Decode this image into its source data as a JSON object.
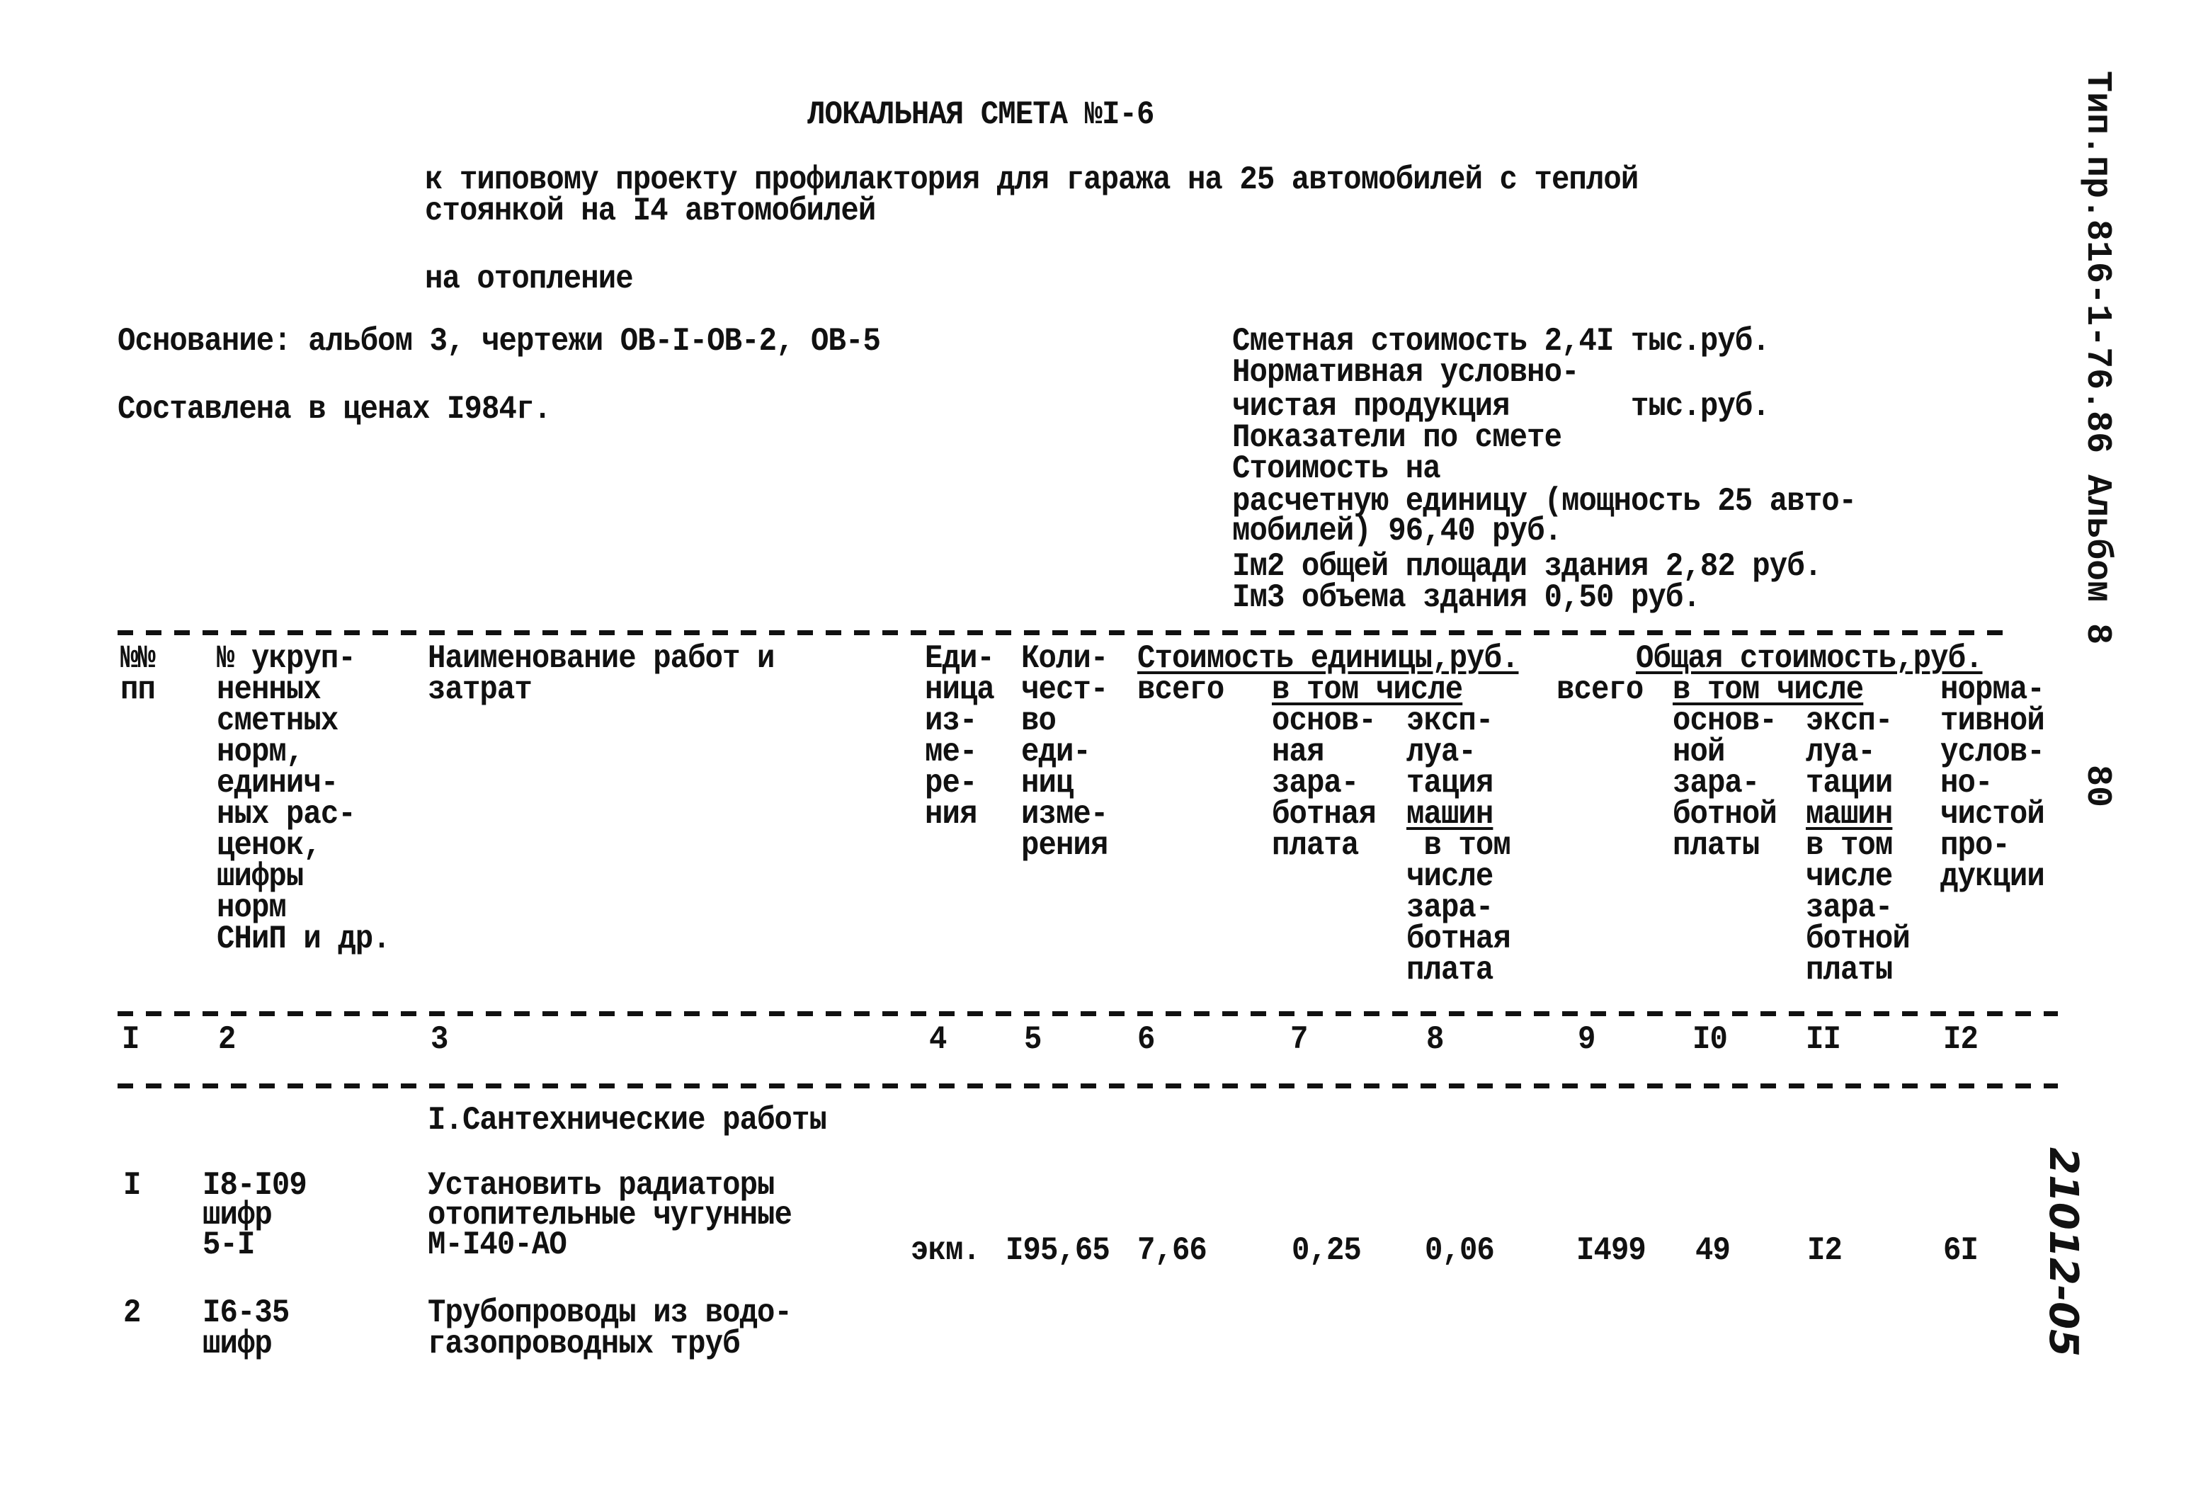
{
  "header": {
    "title": "ЛОКАЛЬНАЯ СМЕТА №I-6",
    "subtitle_line1": "к типовому проекту профилактория для гаража на 25 автомобилей с теплой",
    "subtitle_line2": "стоянкой на I4 автомобилей",
    "purpose": "на отопление"
  },
  "basis": {
    "foundation": "Основание: альбом 3, чертежи ОВ-I-ОВ-2, ОВ-5",
    "prices": "Составлена в ценах I984г."
  },
  "summary": {
    "lines": [
      "Сметная стоимость 2,4I тыс.руб.",
      "Нормативная условно-",
      "чистая продукция       тыс.руб.",
      "Показатели по смете",
      "Стоимость на",
      "расчетную единицу (мощность 25 авто-",
      "мобилей) 96,40 руб.",
      "Iм2 общей площади здания 2,82 руб.",
      "Iм3 объема здания 0,50 руб."
    ]
  },
  "side_stamp": {
    "code": "Тип.пр.816-1-76.86 Альбом 8",
    "page": "80",
    "handwritten": "21012-05"
  },
  "table": {
    "headers": {
      "c1": [
        "№№",
        "пп"
      ],
      "c2": [
        "№ укруп-",
        "ненных",
        "сметных",
        "норм,",
        "единич-",
        "ных рас-",
        "ценок,",
        "шифры",
        "норм",
        "СНиП и др."
      ],
      "c3": [
        "Наименование работ и",
        "затрат"
      ],
      "c4": [
        "Еди-",
        "ница",
        "из-",
        "ме-",
        "ре-",
        "ния"
      ],
      "c5": [
        "Коли-",
        "чест-",
        "во",
        "еди-",
        "ниц",
        "изме-",
        "рения"
      ],
      "unit_cost_group": "Стоимость единицы,руб.",
      "c6": "всего",
      "incl_1": "в том числе",
      "c7": [
        "основ-",
        "ная",
        "зара-",
        "ботная",
        "плата"
      ],
      "c8": [
        "эксп-",
        "луа-",
        "тация",
        "машин",
        " в том",
        "числе",
        "зара-",
        "ботная",
        "плата"
      ],
      "total_cost_group": "Общая стоимость,руб.",
      "c9": "всего",
      "incl_2": "в том числе",
      "c10": [
        "основ-",
        "ной",
        "зара-",
        "ботной",
        "платы"
      ],
      "c11": [
        "эксп-",
        "луа-",
        "тации",
        "машин",
        "в том",
        "числе",
        "зара-",
        "ботной",
        "платы"
      ],
      "c12": [
        "норма-",
        "тивной",
        "услов-",
        "но-",
        "чистой",
        "про-",
        "дукции"
      ]
    },
    "column_numbers": [
      "I",
      "2",
      "3",
      "4",
      "5",
      "6",
      "7",
      "8",
      "9",
      "I0",
      "II",
      "I2"
    ],
    "section_title": "I.Сантехнические работы",
    "rows": [
      {
        "num": "I",
        "code": [
          "I8-I09",
          "шифр",
          "5-I"
        ],
        "name": [
          "Установить радиаторы",
          "отопительные чугунные",
          "М-I40-АО"
        ],
        "unit": "экм.",
        "qty": "I95,65",
        "unit_total": "7,66",
        "unit_wage": "0,25",
        "unit_machine": "0,06",
        "total": "I499",
        "total_wage": "49",
        "total_machine": "I2",
        "normative": "6I"
      },
      {
        "num": "2",
        "code": [
          "I6-35",
          "шифр"
        ],
        "name": [
          "Трубопроводы из водо-",
          "газопроводных труб"
        ],
        "unit": "",
        "qty": "",
        "unit_total": "",
        "unit_wage": "",
        "unit_machine": "",
        "total": "",
        "total_wage": "",
        "total_machine": "",
        "normative": ""
      }
    ]
  }
}
